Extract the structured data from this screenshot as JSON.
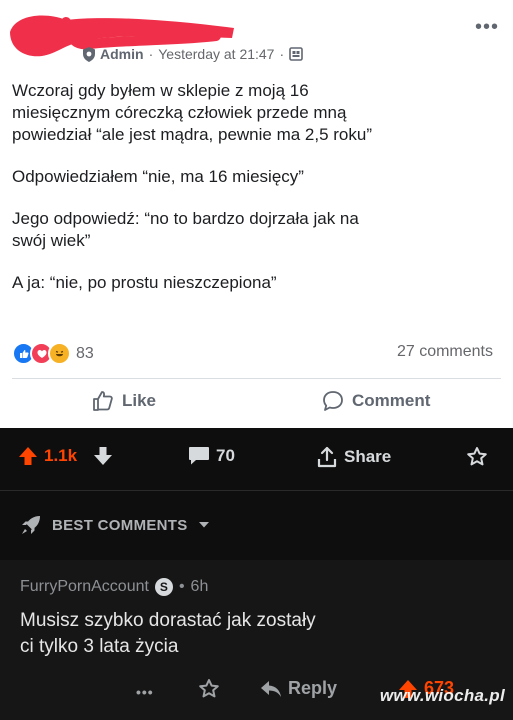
{
  "post": {
    "role": "Admin",
    "separator": "·",
    "time": "Yesterday at 21:47",
    "paragraphs": [
      "Wczoraj gdy byłem w sklepie z moją 16\nmiesięcznym córeczką człowiek przede mną\npowiedział “ale jest mądra, pewnie ma 2,5 roku”",
      "Odpowiedziałem “nie, ma 16 miesięcy”",
      "Jego odpowiedź: “no to bardzo dojrzała jak na\nswój wiek”",
      "A ja: “nie, po prostu nieszczepiona”"
    ],
    "reaction_count": "83",
    "comments_count": "27 comments",
    "like_label": "Like",
    "comment_label": "Comment",
    "more_glyph": "•••"
  },
  "reddit": {
    "upvotes": "1.1k",
    "comment_count": "70",
    "share_label": "Share",
    "sort_label": "BEST COMMENTS",
    "comment": {
      "author": "FurryPornAccount",
      "badge": "S",
      "age": "6h",
      "text": "Musisz szybko dorastać jak zostały\nci tylko 3 lata życia",
      "reply_label": "Reply",
      "score": "673",
      "more_glyph": "•••"
    }
  },
  "watermark": "www.wiocha.pl",
  "colors": {
    "redaction": "#f0304a",
    "reddit_orange": "#ff4500",
    "fb_like_blue": "#1877f2",
    "fb_love_red": "#f33e58",
    "fb_haha_yellow": "#f7b125"
  }
}
